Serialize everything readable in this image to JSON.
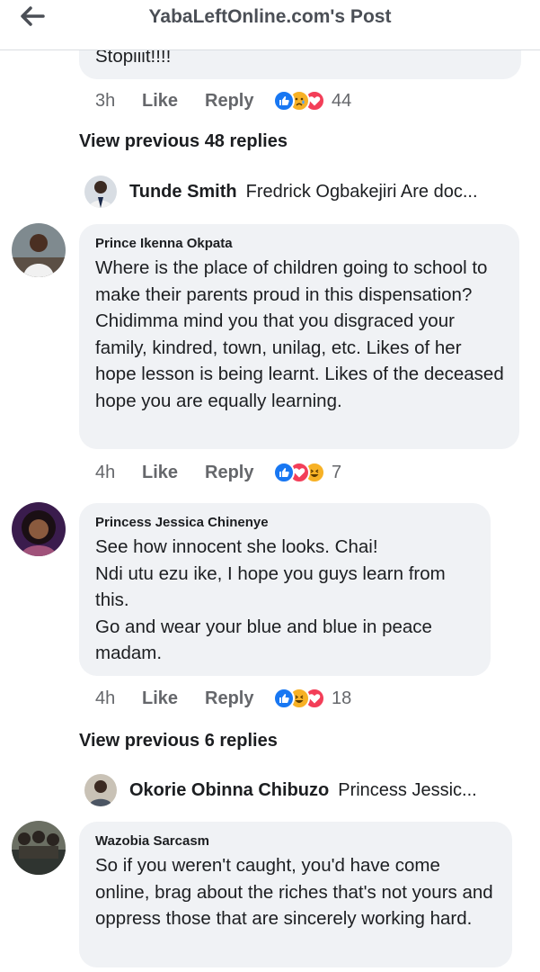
{
  "header": {
    "title": "YabaLeftOnline.com's Post"
  },
  "top_comment": {
    "text_fragment": "Stopiiit!!!!",
    "time": "3h",
    "like_label": "Like",
    "reply_label": "Reply",
    "reactions": [
      "like",
      "sad",
      "love"
    ],
    "reaction_count": "44"
  },
  "view_previous_1": "View previous 48 replies",
  "reply_preview_1": {
    "name": "Tunde Smith",
    "snippet": "Fredrick Ogbakejiri Are doc..."
  },
  "comment_1": {
    "author": "Prince Ikenna Okpata",
    "text": "Where is the place of children going to school to make their parents proud in this dispensation? Chidimma mind you that you disgraced your family, kindred, town, unilag, etc. Likes of her hope lesson is being learnt. Likes of the deceased hope you are equally learning.",
    "time": "4h",
    "like_label": "Like",
    "reply_label": "Reply",
    "reactions": [
      "like",
      "love",
      "haha"
    ],
    "reaction_count": "7"
  },
  "comment_2": {
    "author": "Princess Jessica Chinenye",
    "lines": [
      "See how innocent she looks. Chai!",
      "Ndi utu ezu ike, I hope you guys learn from this.",
      "Go and wear your blue and blue in peace madam."
    ],
    "time": "4h",
    "like_label": "Like",
    "reply_label": "Reply",
    "reactions": [
      "like",
      "haha",
      "love"
    ],
    "reaction_count": "18"
  },
  "view_previous_2": "View previous 6 replies",
  "reply_preview_2": {
    "name": "Okorie Obinna Chibuzo",
    "snippet": "Princess Jessic..."
  },
  "comment_3": {
    "author": "Wazobia Sarcasm",
    "text": "So if you weren't caught, you'd have come online, brag about the riches that's not yours and oppress those that are sincerely working hard."
  },
  "colors": {
    "like_blue": "#1877f2",
    "love_red": "#f33e58",
    "emoji_yellow": "#f7b125",
    "bubble_bg": "#f0f2f5",
    "muted": "#65676b"
  }
}
